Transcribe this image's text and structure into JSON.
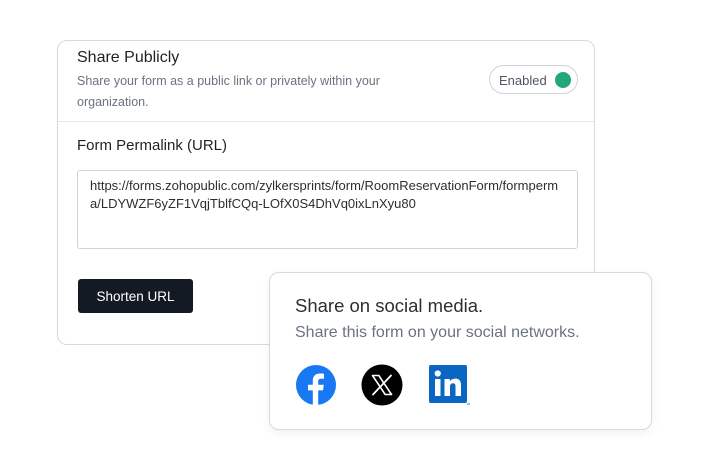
{
  "share_public": {
    "title": "Share Publicly",
    "description": "Share your form as a public link or privately within your organization.",
    "toggle": {
      "label": "Enabled",
      "state": "on",
      "accent_color": "#22a67a"
    }
  },
  "permalink": {
    "label": "Form Permalink (URL)",
    "url": "https://forms.zohopublic.com/zylkersprints/form/RoomReservationForm/formperma/LDYWZF6yZF1VqjTblfCQq-LOfX0S4DhVq0ixLnXyu80"
  },
  "actions": {
    "shorten_label": "Shorten URL"
  },
  "social": {
    "title": "Share on social media.",
    "description": "Share this form on your social networks.",
    "networks": [
      {
        "icon": "facebook-icon",
        "color": "#1877f2"
      },
      {
        "icon": "x-icon",
        "color": "#000000"
      },
      {
        "icon": "linkedin-icon",
        "color": "#0a66c2"
      }
    ]
  }
}
